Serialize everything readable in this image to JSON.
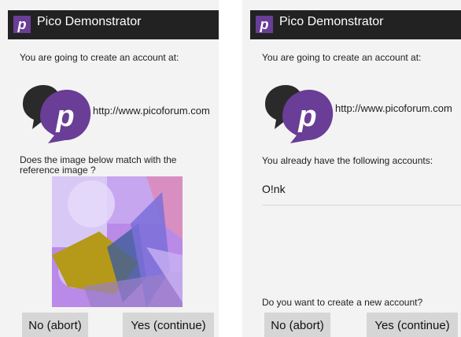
{
  "colors": {
    "titlebar": "#222222",
    "brand_purple": "#6a3d96",
    "bubble_dark": "#2a2a2a",
    "button_bg": "#d6d6d6"
  },
  "icons": {
    "app": "pico-p-icon",
    "logo": "pico-chat-bubbles-logo",
    "captcha": "captcha-image"
  },
  "left": {
    "app_icon_letter": "p",
    "app_title": "Pico Demonstrator",
    "intro": "You are going to create an account at:",
    "logo_letter": "p",
    "url": "http://www.picoforum.com",
    "question": "Does the image below match with the reference image ?",
    "no_button": "No (abort)",
    "yes_button": "Yes (continue)"
  },
  "right": {
    "app_icon_letter": "p",
    "app_title": "Pico Demonstrator",
    "intro": "You are going to create an account at:",
    "logo_letter": "p",
    "url": "http://www.picoforum.com",
    "accounts_label": "You already have the following accounts:",
    "accounts": [
      "O!nk"
    ],
    "create_question": "Do you want to create a new account?",
    "no_button": "No (abort)",
    "yes_button": "Yes (continue)"
  }
}
